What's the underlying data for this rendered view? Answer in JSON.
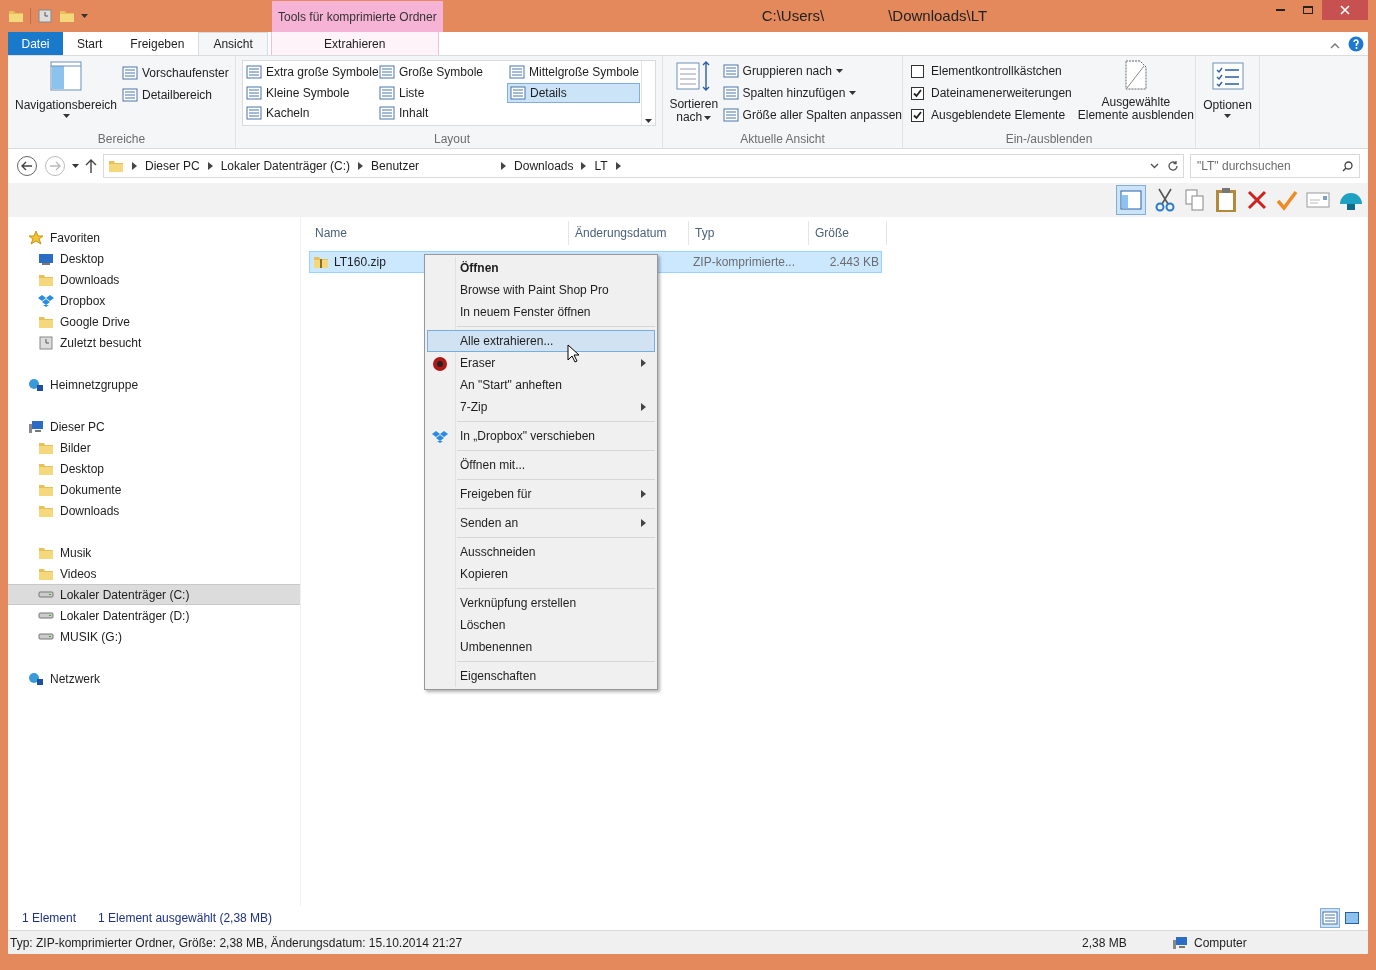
{
  "window": {
    "title_parts": [
      "C:\\Users\\",
      "\\Downloads\\LT"
    ],
    "contextual_header": "Tools für komprimierte Ordner"
  },
  "ribbon_tabs": [
    {
      "label": "Datei",
      "kind": "file",
      "selected": false
    },
    {
      "label": "Start",
      "kind": "tab",
      "selected": false
    },
    {
      "label": "Freigeben",
      "kind": "tab",
      "selected": false
    },
    {
      "label": "Ansicht",
      "kind": "tab",
      "selected": true
    },
    {
      "label": "Extrahieren",
      "kind": "contextual",
      "selected": false
    }
  ],
  "ribbon": {
    "bereiche": {
      "label": "Bereiche",
      "large": "Navigationsbereich",
      "small": [
        "Vorschaufenster",
        "Detailbereich"
      ]
    },
    "layout": {
      "label": "Layout",
      "items": [
        {
          "label": "Extra große Symbole",
          "selected": false
        },
        {
          "label": "Kleine Symbole",
          "selected": false
        },
        {
          "label": "Kacheln",
          "selected": false
        },
        {
          "label": "Große Symbole",
          "selected": false
        },
        {
          "label": "Liste",
          "selected": false
        },
        {
          "label": "Inhalt",
          "selected": false
        },
        {
          "label": "Mittelgroße Symbole",
          "selected": false
        },
        {
          "label": "Details",
          "selected": true
        }
      ]
    },
    "ansicht": {
      "label": "Aktuelle Ansicht",
      "large_lines": [
        "Sortieren",
        "nach"
      ],
      "small": [
        {
          "label": "Gruppieren nach",
          "dropdown": true
        },
        {
          "label": "Spalten hinzufügen",
          "dropdown": true
        },
        {
          "label": "Größe aller Spalten anpassen",
          "dropdown": false
        }
      ]
    },
    "ein_aus": {
      "label": "Ein-/ausblenden",
      "checks": [
        {
          "label": "Elementkontrollkästchen",
          "checked": false
        },
        {
          "label": "Dateinamenerweiterungen",
          "checked": true
        },
        {
          "label": "Ausgeblendete Elemente",
          "checked": true
        }
      ],
      "large_lines": [
        "Ausgewählte",
        "Elemente ausblenden"
      ]
    },
    "optionen": {
      "label": "Optionen"
    }
  },
  "address": {
    "crumbs": [
      "Dieser PC",
      "Lokaler Datenträger (C:)",
      "Benutzer",
      "Downloads",
      "LT"
    ],
    "search_placeholder": "\"LT\" durchsuchen"
  },
  "navigation": [
    {
      "label": "Favoriten",
      "kind": "star",
      "selected": false,
      "children": [
        {
          "label": "Desktop",
          "kind": "monitor",
          "selected": false
        },
        {
          "label": "Downloads",
          "kind": "folder",
          "selected": false
        },
        {
          "label": "Dropbox",
          "kind": "box",
          "selected": false
        },
        {
          "label": "Google Drive",
          "kind": "folder",
          "selected": false
        },
        {
          "label": "Zuletzt besucht",
          "kind": "clock",
          "selected": false
        }
      ]
    },
    {
      "label": "Heimnetzgruppe",
      "kind": "network",
      "selected": false
    },
    {
      "label": "Dieser PC",
      "kind": "pc",
      "selected": false,
      "children": [
        {
          "label": "Bilder",
          "kind": "folder",
          "selected": false
        },
        {
          "label": "Desktop",
          "kind": "folder",
          "selected": false
        },
        {
          "label": "Dokumente",
          "kind": "folder",
          "selected": false
        },
        {
          "label": "Downloads",
          "kind": "folder",
          "selected": false
        },
        {
          "kind": "blank"
        },
        {
          "label": "Musik",
          "kind": "folder",
          "selected": false
        },
        {
          "label": "Videos",
          "kind": "folder",
          "selected": false
        },
        {
          "label": "Lokaler Datenträger (C:)",
          "kind": "drive",
          "selected": true
        },
        {
          "label": "Lokaler Datenträger (D:)",
          "kind": "drive",
          "selected": false
        },
        {
          "label": "MUSIK (G:)",
          "kind": "drive",
          "selected": false
        }
      ]
    },
    {
      "label": "Netzwerk",
      "kind": "network",
      "selected": false
    }
  ],
  "table": {
    "columns": [
      "Name",
      "Änderungsdatum",
      "Typ",
      "Größe"
    ],
    "rows": [
      {
        "name": "LT160.zip",
        "type": "ZIP-komprimierte...",
        "size": "2.443 KB",
        "selected": true
      }
    ]
  },
  "context_menu": [
    {
      "kind": "item",
      "label": "Öffnen",
      "bold": true,
      "selected": false,
      "submenu": false
    },
    {
      "kind": "item",
      "label": "Browse with Paint Shop Pro",
      "bold": false,
      "selected": false,
      "submenu": false
    },
    {
      "kind": "item",
      "label": "In neuem Fenster öffnen",
      "bold": false,
      "selected": false,
      "submenu": false
    },
    {
      "kind": "separator"
    },
    {
      "kind": "item",
      "label": "Alle extrahieren...",
      "bold": false,
      "selected": true,
      "submenu": false
    },
    {
      "kind": "item",
      "label": "Eraser",
      "bold": false,
      "selected": false,
      "submenu": true
    },
    {
      "kind": "item",
      "label": "An \"Start\" anheften",
      "bold": false,
      "selected": false,
      "submenu": false
    },
    {
      "kind": "item",
      "label": "7-Zip",
      "bold": false,
      "selected": false,
      "submenu": true
    },
    {
      "kind": "separator"
    },
    {
      "kind": "item",
      "label": "In „Dropbox\" verschieben",
      "bold": false,
      "selected": false,
      "submenu": false
    },
    {
      "kind": "separator"
    },
    {
      "kind": "item",
      "label": "Öffnen mit...",
      "bold": false,
      "selected": false,
      "submenu": false
    },
    {
      "kind": "separator"
    },
    {
      "kind": "item",
      "label": "Freigeben für",
      "bold": false,
      "selected": false,
      "submenu": true
    },
    {
      "kind": "separator"
    },
    {
      "kind": "item",
      "label": "Senden an",
      "bold": false,
      "selected": false,
      "submenu": true
    },
    {
      "kind": "separator"
    },
    {
      "kind": "item",
      "label": "Ausschneiden",
      "bold": false,
      "selected": false,
      "submenu": false
    },
    {
      "kind": "item",
      "label": "Kopieren",
      "bold": false,
      "selected": false,
      "submenu": false
    },
    {
      "kind": "separator"
    },
    {
      "kind": "item",
      "label": "Verknüpfung erstellen",
      "bold": false,
      "selected": false,
      "submenu": false
    },
    {
      "kind": "item",
      "label": "Löschen",
      "bold": false,
      "selected": false,
      "submenu": false
    },
    {
      "kind": "item",
      "label": "Umbenennen",
      "bold": false,
      "selected": false,
      "submenu": false
    },
    {
      "kind": "separator"
    },
    {
      "kind": "item",
      "label": "Eigenschaften",
      "bold": false,
      "selected": false,
      "submenu": false
    }
  ],
  "status": {
    "count": "1 Element",
    "selection": "1 Element ausgewählt (2,38 MB)",
    "views": [
      {
        "kind": "details",
        "selected": true
      },
      {
        "kind": "large",
        "selected": false
      }
    ]
  },
  "details_bar": {
    "info": "Typ: ZIP-komprimierter Ordner, Größe: 2,38 MB, Änderungsdatum: 15.10.2014 21:27",
    "size": "2,38 MB",
    "location": "Computer"
  }
}
